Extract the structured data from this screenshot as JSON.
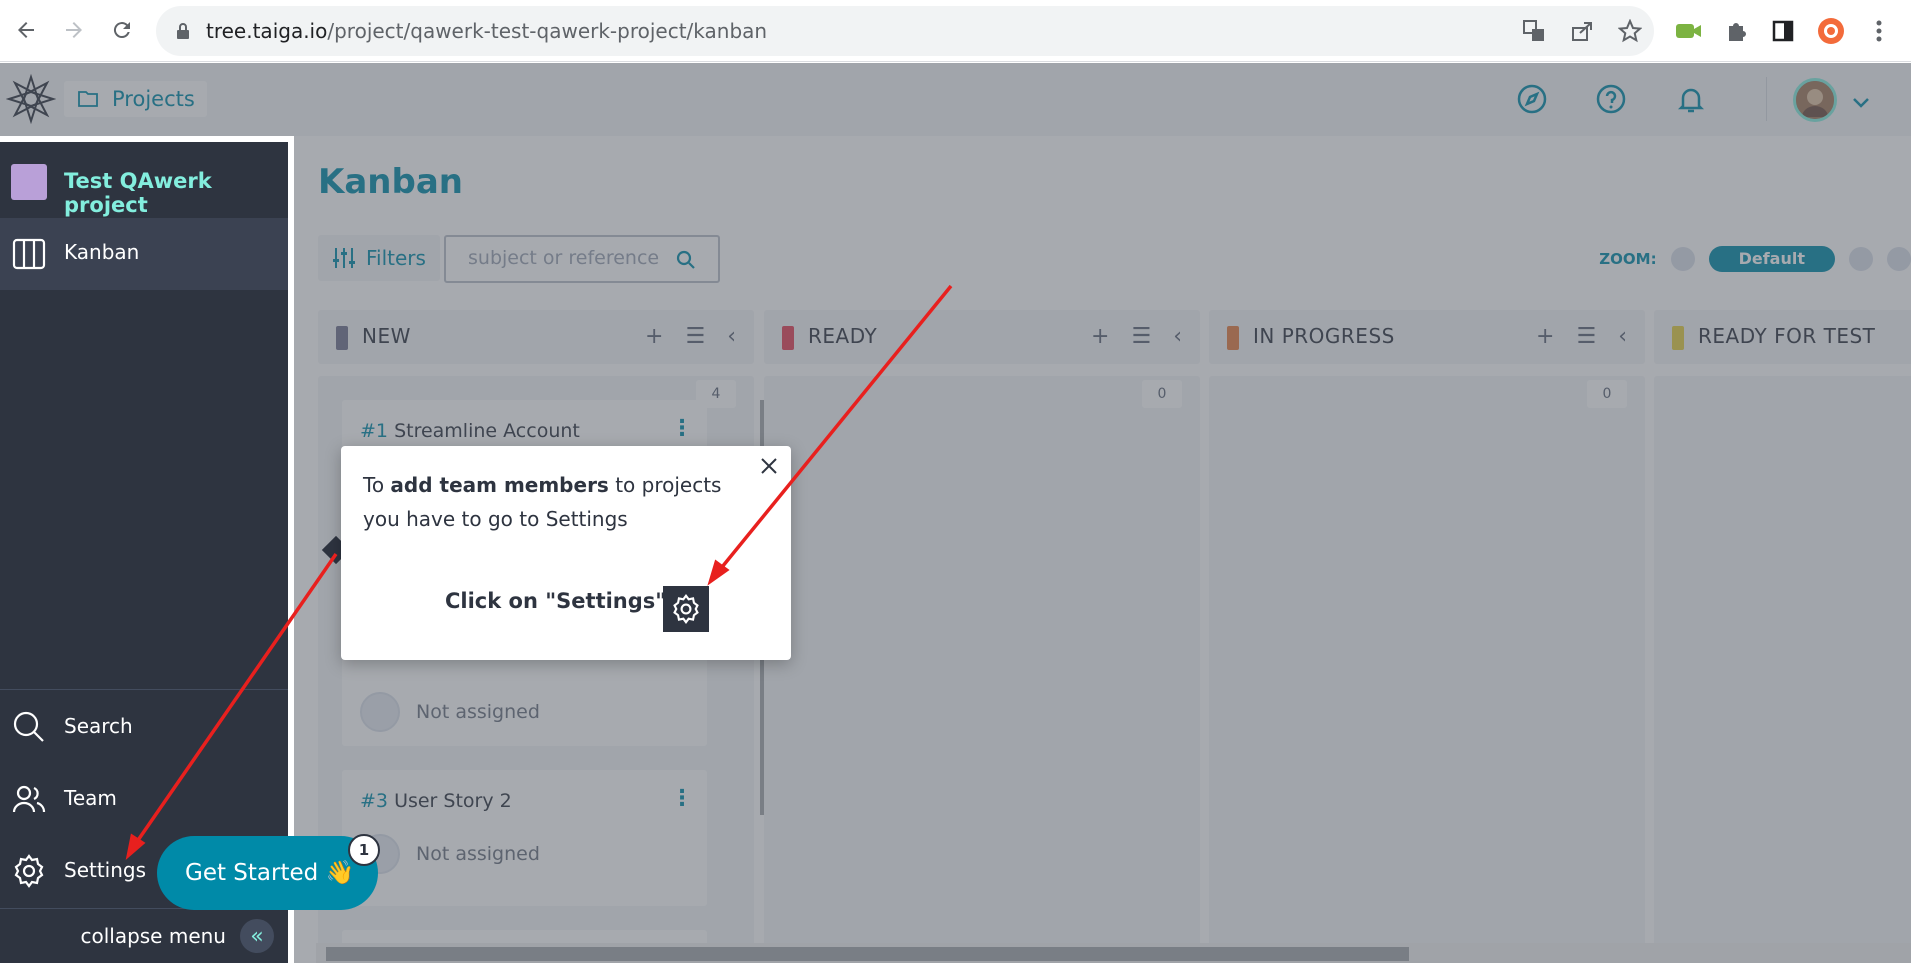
{
  "browser": {
    "url_host": "tree.taiga.io",
    "url_path": "/project/qawerk-test-qawerk-project/kanban"
  },
  "topbar": {
    "projects_label": "Projects"
  },
  "sidebar": {
    "project_name": "Test QAwerk project",
    "kanban_label": "Kanban",
    "search_label": "Search",
    "team_label": "Team",
    "settings_label": "Settings",
    "collapse_label": "collapse menu"
  },
  "main": {
    "title": "Kanban",
    "filters_label": "Filters",
    "search_placeholder": "subject or reference",
    "zoom_label": "ZOOM:",
    "zoom_selected": "Default"
  },
  "columns": [
    {
      "title": "NEW",
      "color": "#70728f",
      "count": "4"
    },
    {
      "title": "READY",
      "color": "#e44057",
      "count": "0"
    },
    {
      "title": "IN PROGRESS",
      "color": "#e47c40",
      "count": "0"
    },
    {
      "title": "READY FOR TEST",
      "color": "#e4ce40",
      "count": ""
    }
  ],
  "cards": [
    {
      "ref": "#1",
      "title": "Streamline Account",
      "assignee": "Not assigned"
    },
    {
      "ref": "#3",
      "title": "User Story 2",
      "assignee": "Not assigned"
    }
  ],
  "popover": {
    "text_before": "To",
    "text_bold": "add team members",
    "text_after": "to projects you have to go to Settings",
    "cta": "Click on \"Settings\""
  },
  "get_started": {
    "label": "Get Started",
    "badge": "1"
  }
}
